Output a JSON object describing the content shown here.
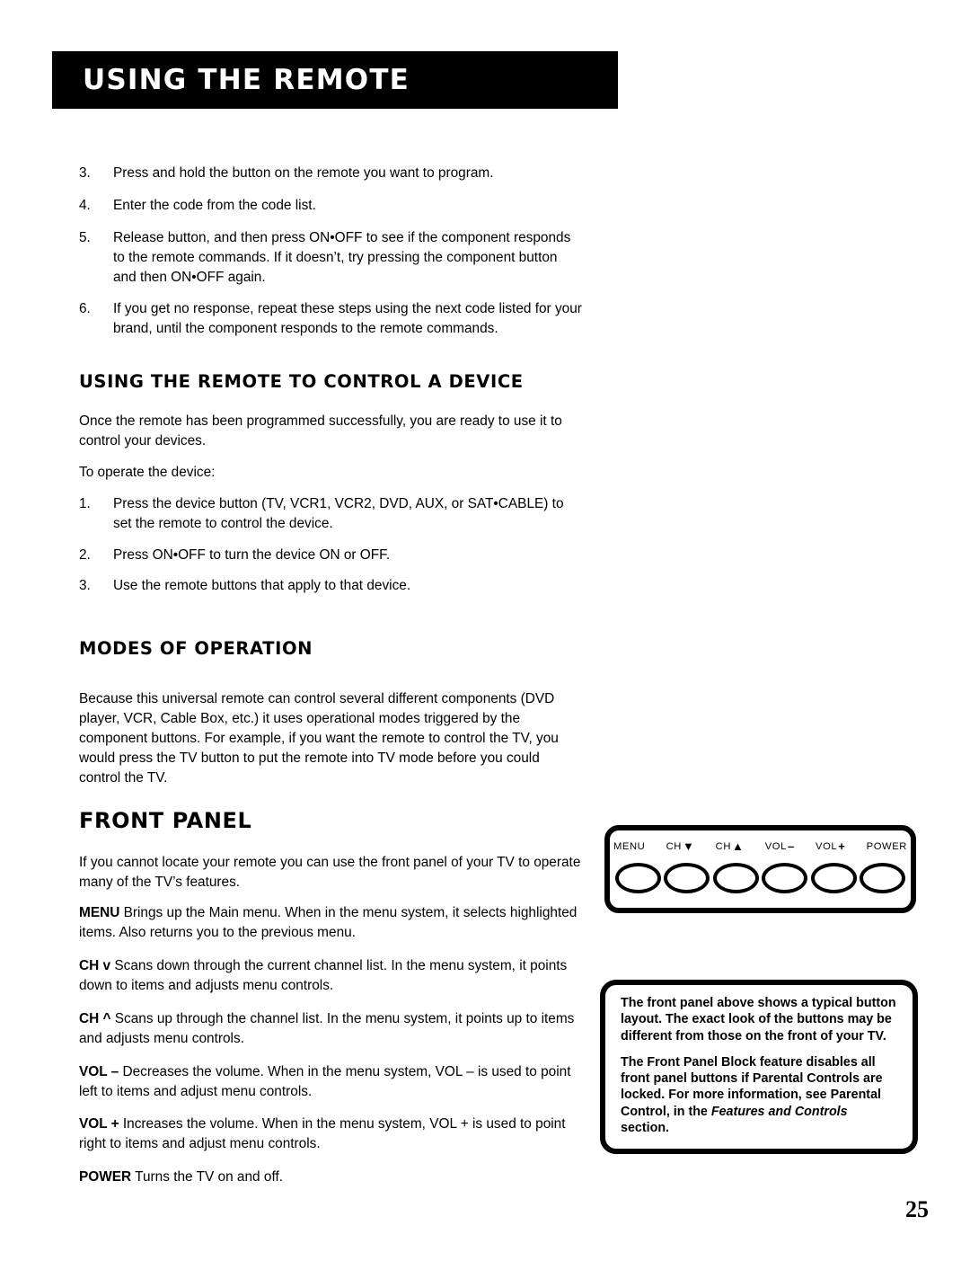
{
  "header": {
    "title": "USING THE REMOTE",
    "banner_color": "#000000",
    "text_color": "#FFFFFF"
  },
  "steps_continued": [
    {
      "num": "3.",
      "text": "Press and hold the button on the remote you want to program."
    },
    {
      "num": "4.",
      "text": "Enter the code from the code list."
    },
    {
      "num": "5.",
      "text": "Release button, and then press ON•OFF to see if the component responds to the remote commands. If it doesn’t, try pressing the component button and then ON•OFF again."
    },
    {
      "num": "6.",
      "text": "If you get no response, repeat these steps using the next code listed for your brand, until the component responds to the remote commands."
    }
  ],
  "section_control_device": {
    "heading": "USING THE REMOTE TO CONTROL A DEVICE",
    "intro": "Once the remote has been programmed successfully, you are ready to use it to control your devices.",
    "lead_in": "To operate the device:",
    "steps": [
      {
        "num": "1.",
        "text": "Press the device button (TV, VCR1, VCR2, DVD, AUX, or SAT•CABLE) to set the remote to control the device."
      },
      {
        "num": "2.",
        "text": "Press ON•OFF to turn the device ON or OFF."
      },
      {
        "num": "3.",
        "text": "Use the remote buttons that apply to that device."
      }
    ]
  },
  "section_modes": {
    "heading": "MODES OF OPERATION",
    "body": "Because this universal remote can control several different components (DVD player, VCR, Cable Box, etc.) it uses operational modes triggered by the component buttons. For example, if you want the remote to control the TV, you would press the TV button to put the remote into TV mode before you could control the TV."
  },
  "section_front_panel": {
    "heading": "FRONT PANEL",
    "intro": "If you cannot locate your remote you can use the front panel of your TV to operate many of the TV’s features.",
    "definitions": [
      {
        "term": "MENU",
        "text": "Brings up the Main menu. When in the menu system, it selects highlighted items. Also returns you to the previous menu."
      },
      {
        "term": "CH v",
        "text": "Scans down through the current channel list. In the menu system, it points down to items and adjusts menu controls."
      },
      {
        "term": "CH ^",
        "text": "Scans up through the channel list. In the menu system, it points up to items and adjusts menu controls."
      },
      {
        "term": "VOL –",
        "text": "Decreases the volume. When in the menu system, VOL – is used to point left to items and adjust menu controls."
      },
      {
        "term": "VOL +",
        "text": "Increases the volume. When in the menu system, VOL + is used to point right to items and adjust menu controls."
      },
      {
        "term": "POWER",
        "text": "Turns the TV on and off."
      }
    ]
  },
  "front_panel_diagram": {
    "buttons": [
      {
        "label": "MENU",
        "symbol": ""
      },
      {
        "label": "CH",
        "symbol": "▼"
      },
      {
        "label": "CH",
        "symbol": "▲"
      },
      {
        "label": "VOL",
        "symbol": "–"
      },
      {
        "label": "VOL",
        "symbol": "+"
      },
      {
        "label": "POWER",
        "symbol": ""
      }
    ]
  },
  "note_box": {
    "paragraph_1": "The front panel above shows a typical button layout. The exact look of the buttons may be different from those on the front of your TV.",
    "paragraph_2_pre": "The Front Panel Block feature disables all front panel buttons if Parental Controls are locked. For more information, see Parental Control, in the ",
    "paragraph_2_italic": "Features and Controls",
    "paragraph_2_post": " section."
  },
  "footer": {
    "page_number": "25"
  }
}
